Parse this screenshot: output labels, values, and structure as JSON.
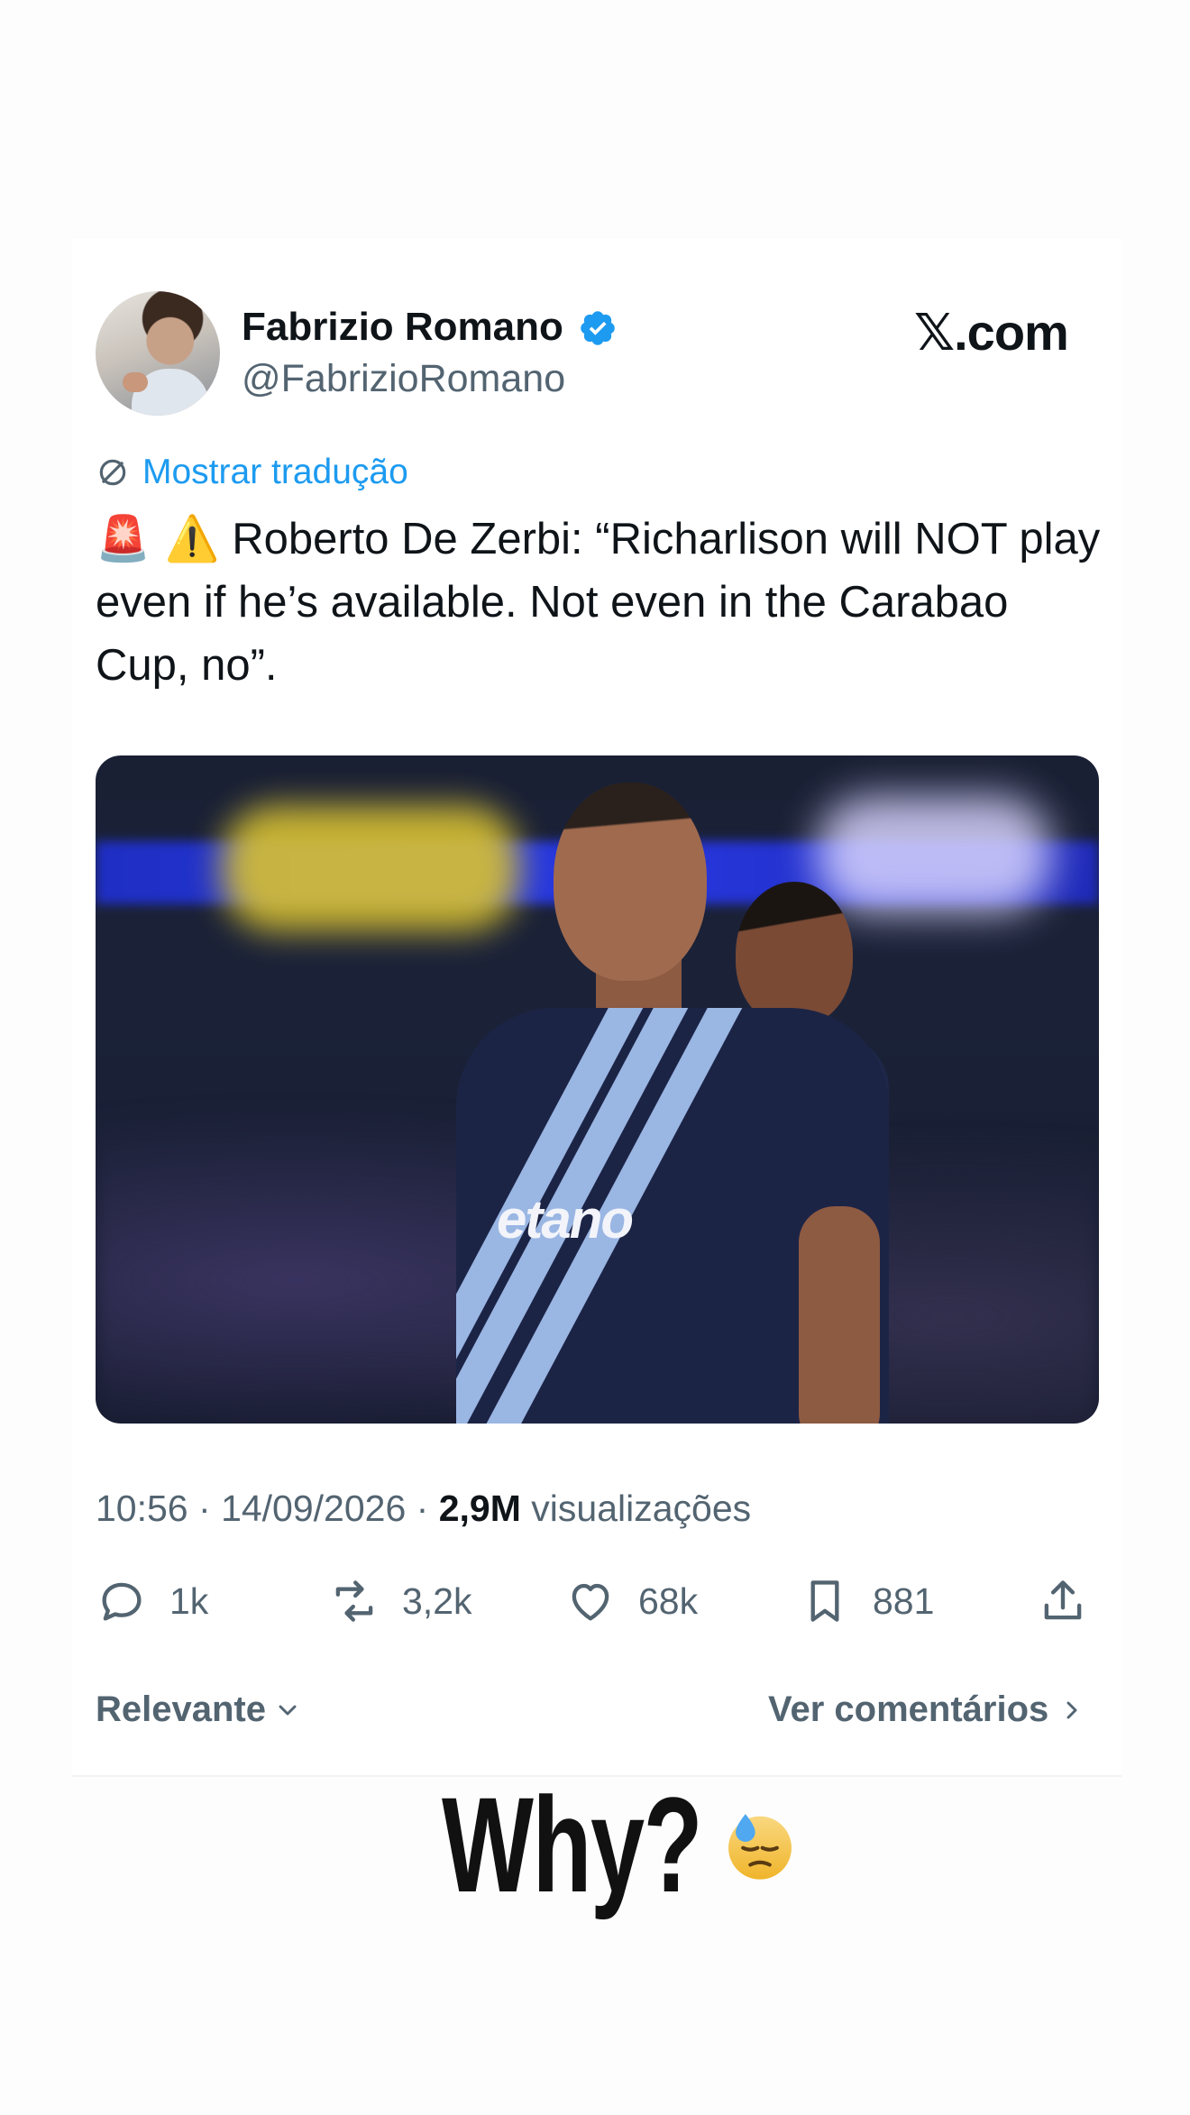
{
  "tweet": {
    "author_name": "Fabrizio Romano",
    "author_handle": "@FabrizioRomano",
    "brand": "𝕏.com",
    "translate_label": "Mostrar tradução",
    "text": "Roberto De Zerbi: “Richarlison will NOT play even if he’s available. Not even in the Carabao Cup, no”.",
    "text_emojis": "🚨 ⚠️",
    "image_sponsor_text": "etano",
    "meta": {
      "time": "10:56",
      "date": "14/09/2026",
      "views_count": "2,9M",
      "views_label": "visualizações"
    },
    "actions": {
      "replies": "1k",
      "reposts": "3,2k",
      "likes": "68k",
      "bookmarks": "881"
    },
    "sort_label": "Relevante",
    "view_comments_label": "Ver comentários"
  },
  "caption": {
    "text": "Why?",
    "emoji": "😓"
  },
  "colors": {
    "accent": "#1d9bf0",
    "secondary_text": "#536471",
    "primary_text": "#0f1419"
  },
  "icons": [
    "verified-badge-icon",
    "translate-icon",
    "reply-icon",
    "repost-icon",
    "like-icon",
    "bookmark-icon",
    "share-icon",
    "chevron-down-icon",
    "chevron-right-icon"
  ]
}
